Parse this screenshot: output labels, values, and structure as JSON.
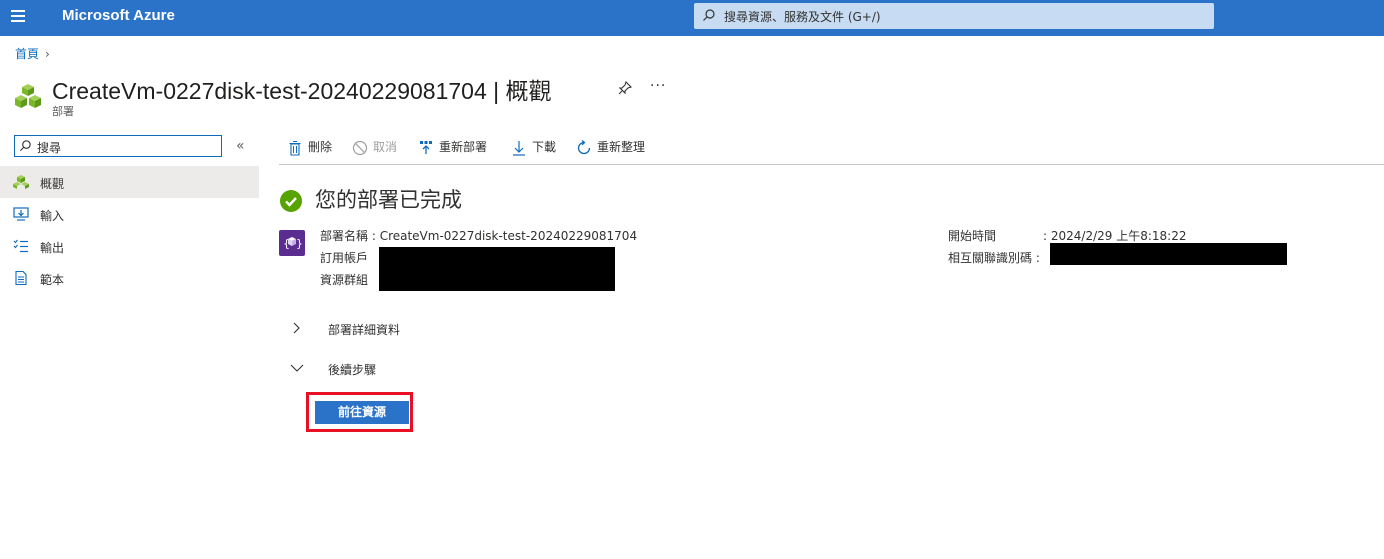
{
  "app": {
    "brand": "Microsoft Azure",
    "search_placeholder": "搜尋資源、服務及文件 (G+/)"
  },
  "breadcrumb": {
    "home": "首頁"
  },
  "header": {
    "title": "CreateVm-0227disk-test-20240229081704 | 概觀",
    "subtitle": "部署",
    "more": "···"
  },
  "sidebar": {
    "search_value": "搜尋",
    "items": [
      {
        "label": "概觀",
        "icon": "overview-icon",
        "active": true
      },
      {
        "label": "輸入",
        "icon": "inputs-icon"
      },
      {
        "label": "輸出",
        "icon": "outputs-icon"
      },
      {
        "label": "範本",
        "icon": "template-icon"
      }
    ]
  },
  "toolbar": {
    "delete": "刪除",
    "cancel": "取消",
    "redeploy": "重新部署",
    "download": "下載",
    "refresh": "重新整理"
  },
  "status": {
    "heading": "您的部署已完成"
  },
  "details": {
    "name_label": "部署名稱",
    "name_value": "CreateVm-0227disk-test-20240229081704",
    "subscription_label": "訂用帳戶",
    "resource_group_label": "資源群組",
    "start_time_label": "開始時間",
    "start_time_value": "2024/2/29 上午8:18:22",
    "correlation_label": "相互關聯識別碼"
  },
  "sections": {
    "deployment_details": "部署詳細資料",
    "next_steps": "後續步驟"
  },
  "actions": {
    "go_to_resource": "前往資源"
  },
  "colors": {
    "topbar": "#2b73c9",
    "accent": "#0f6cbd",
    "success": "#57a300",
    "highlight": "#e81123"
  }
}
